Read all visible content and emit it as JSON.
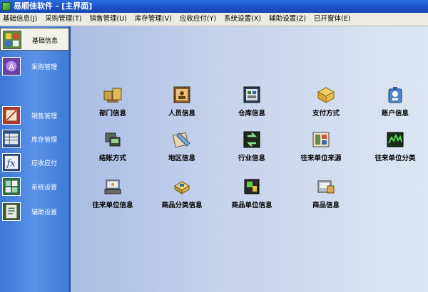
{
  "window": {
    "title": "易顺佳软件 - [主界面]"
  },
  "menu": [
    "基础信息(J)",
    "采购管理(T)",
    "销售管理(U)",
    "库存管理(V)",
    "应收应付(Y)",
    "系统设置(X)",
    "辅助设置(Z)",
    "已开窗体(E)"
  ],
  "sidebar": {
    "items": [
      {
        "label": "基础信息",
        "active": true
      },
      {
        "label": "采购管理"
      },
      {
        "label": "销售管理"
      },
      {
        "label": "库存管理"
      },
      {
        "label": "应收应付"
      },
      {
        "label": "系统设置"
      },
      {
        "label": "辅助设置"
      }
    ]
  },
  "tiles": [
    {
      "label": "部门信息",
      "icon": "department-icon"
    },
    {
      "label": "人员信息",
      "icon": "personnel-icon"
    },
    {
      "label": "仓库信息",
      "icon": "warehouse-icon"
    },
    {
      "label": "支付方式",
      "icon": "payment-icon"
    },
    {
      "label": "账户信息",
      "icon": "account-icon"
    },
    {
      "label": "结账方式",
      "icon": "settlement-icon"
    },
    {
      "label": "地区信息",
      "icon": "region-icon"
    },
    {
      "label": "行业信息",
      "icon": "industry-icon"
    },
    {
      "label": "往来单位来源",
      "icon": "partner-source-icon"
    },
    {
      "label": "往来单位分类",
      "icon": "partner-category-icon"
    },
    {
      "label": "往来单位信息",
      "icon": "partner-info-icon"
    },
    {
      "label": "商品分类信息",
      "icon": "product-category-icon"
    },
    {
      "label": "商品单位信息",
      "icon": "product-unit-icon"
    },
    {
      "label": "商品信息",
      "icon": "product-info-icon"
    }
  ]
}
